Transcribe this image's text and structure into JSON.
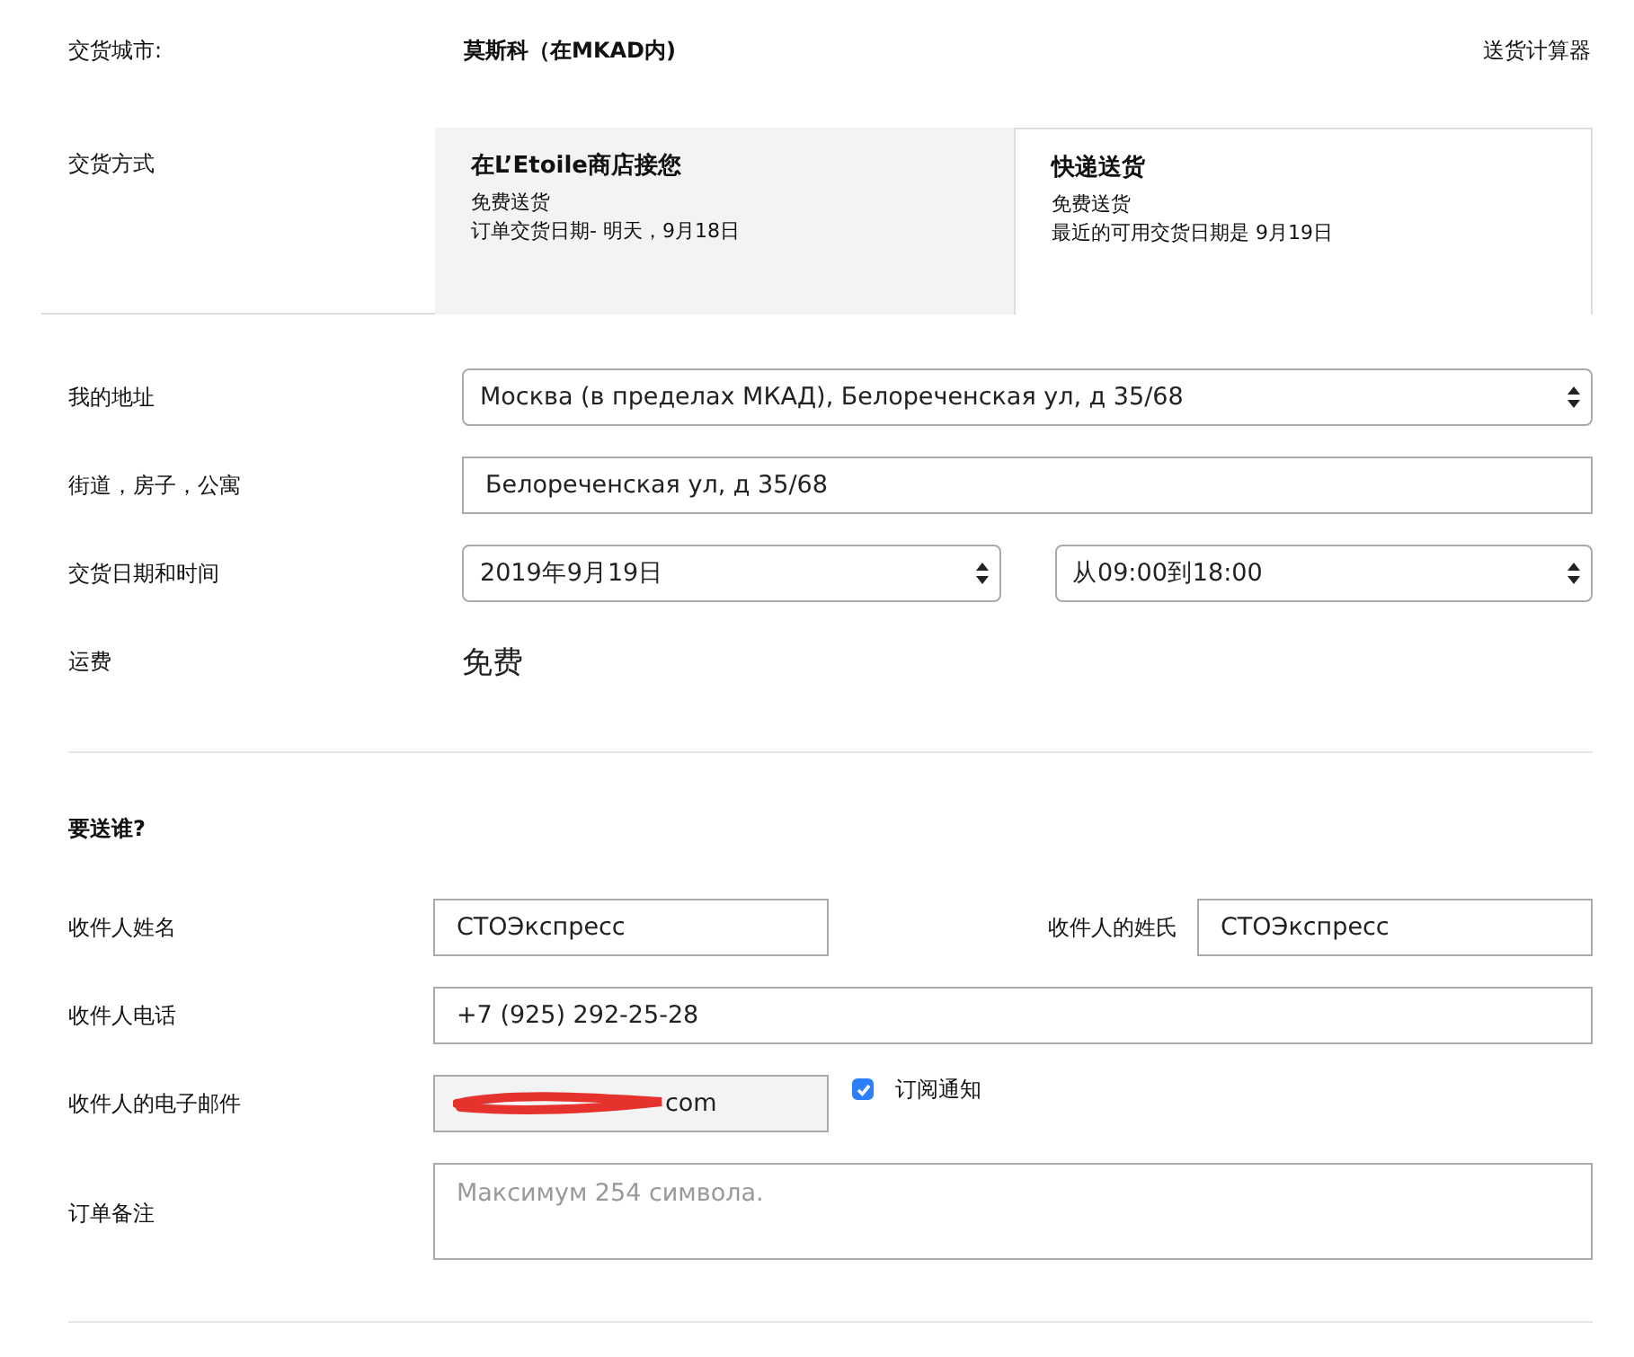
{
  "city": {
    "label": "交货城市:",
    "value": "莫斯科（在MKAD内)",
    "link": "送货计算器"
  },
  "delivery": {
    "label": "交货方式",
    "options": [
      {
        "title": "在L’Etoile商店接您",
        "lines": [
          "免费送货",
          "订单交货日期-  明天，9月18日"
        ],
        "selected": false
      },
      {
        "title": "快递送货",
        "lines": [
          "免费送货",
          "最近的可用交货日期是 9月19日"
        ],
        "selected": true
      }
    ]
  },
  "address": [
    {
      "kind": "select",
      "label": "我的地址",
      "fields": [
        {
          "value": "Москва (в пределах МКАД), Белореченская ул, д 35/68"
        }
      ]
    },
    {
      "kind": "input",
      "label": "街道，房子，公寓",
      "fields": [
        {
          "value": "Белореченская ул, д 35/68"
        }
      ]
    },
    {
      "kind": "select",
      "label": "交货日期和时间",
      "fields": [
        {
          "value": "2019年9月19日"
        },
        {
          "value": "从09:00到18:00"
        }
      ]
    },
    {
      "kind": "text",
      "label": "运费",
      "text": "免费"
    }
  ],
  "recipient": {
    "heading": "要送谁?",
    "first_name": {
      "label": "收件人姓名",
      "value": "СТОЭкспресс"
    },
    "last_name": {
      "label": "收件人的姓氏",
      "value": "СТОЭкспресс"
    },
    "phone": {
      "label": "收件人电话",
      "value": "+7 (925) 292-25-28"
    },
    "email": {
      "label": "收件人的电子邮件",
      "value": "com",
      "disabled": true
    },
    "subscribe": {
      "label": "订阅通知",
      "checked": true
    },
    "note": {
      "label": "订单备注",
      "placeholder": "Максимум 254 символа."
    }
  }
}
